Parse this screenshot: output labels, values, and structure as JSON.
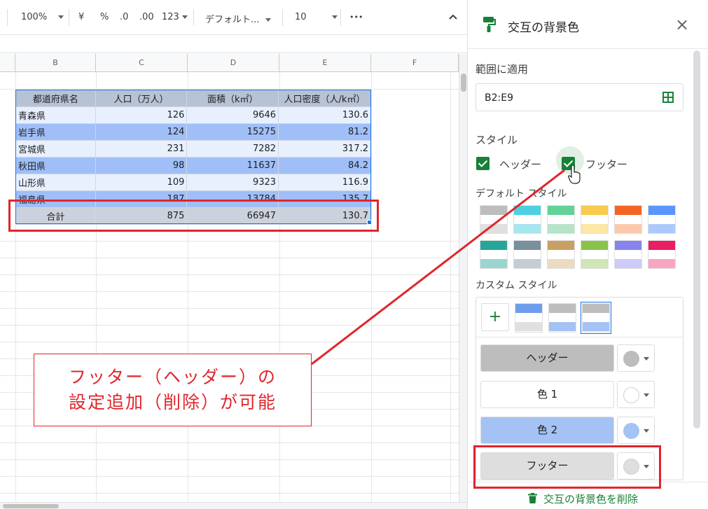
{
  "toolbar": {
    "zoom": "100%",
    "currency": "¥",
    "percent": "%",
    "dec_decrease": ".0",
    "dec_increase": ".00",
    "format_123": "123",
    "font": "デフォルト...",
    "font_size": "10",
    "more": "•••"
  },
  "grid": {
    "columns": [
      "B",
      "C",
      "D",
      "E",
      "F"
    ],
    "table": {
      "header": [
        "都道府県名",
        "人口（万人）",
        "面積（k㎡）",
        "人口密度（人/k㎡）"
      ],
      "rows": [
        [
          "青森県",
          "126",
          "9646",
          "130.6"
        ],
        [
          "岩手県",
          "124",
          "15275",
          "81.2"
        ],
        [
          "宮城県",
          "231",
          "7282",
          "317.2"
        ],
        [
          "秋田県",
          "98",
          "11637",
          "84.2"
        ],
        [
          "山形県",
          "109",
          "9323",
          "116.9"
        ],
        [
          "福島県",
          "187",
          "13784",
          "135.7"
        ]
      ],
      "footer": [
        "合計",
        "875",
        "66947",
        "130.7"
      ]
    }
  },
  "annotation": {
    "line1": "フッター（ヘッダー）の",
    "line2": "設定追加（削除）が可能",
    "color": "#e0252b"
  },
  "panel": {
    "title": "交互の背景色",
    "apply_range_label": "範囲に適用",
    "range_value": "B2:E9",
    "style_label": "スタイル",
    "header_checkbox": "ヘッダー",
    "footer_checkbox": "フッター",
    "default_styles_label": "デフォルト スタイル",
    "custom_styles_label": "カスタム スタイル",
    "add_custom": "+",
    "roles": [
      {
        "label": "ヘッダー",
        "color": "#bdbdbd"
      },
      {
        "label": "色 1",
        "color": "#ffffff"
      },
      {
        "label": "色 2",
        "color": "#a4c2f4"
      },
      {
        "label": "フッター",
        "color": "#dedede"
      }
    ],
    "remove_label": "交互の背景色を削除",
    "accent": "#188038"
  }
}
